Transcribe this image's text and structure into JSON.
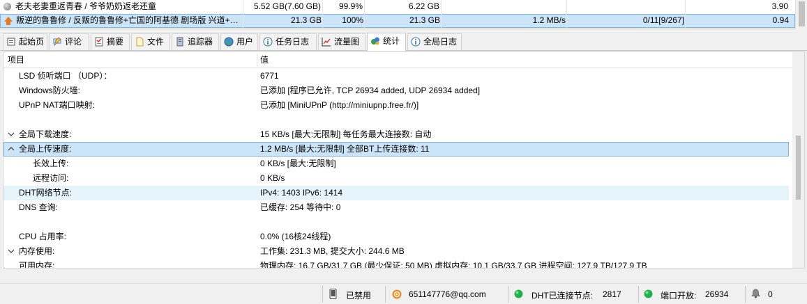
{
  "torrents": [
    {
      "name": "老夫老妻重返青春 / 爷爷奶奶返老还童",
      "size": "5.52 GB(7.60 GB)",
      "done": "99.9%",
      "selected_size": "6.22 GB",
      "down_speed": "",
      "peers": "",
      "ratio": "3.90",
      "state_icon": "paused-gray-dot-icon"
    },
    {
      "name": "叛逆的鲁鲁修 / 反叛的鲁鲁修+亡国的阿基德 剧场版 兴道+…",
      "size": "21.3 GB",
      "done": "100%",
      "selected_size": "21.3 GB",
      "down_speed": "1.2 MB/s",
      "peers": "0/11[9/267]",
      "ratio": "0.94",
      "state_icon": "seeding-up-arrow-icon"
    }
  ],
  "tabs": [
    {
      "label": "起始页",
      "icon": "home-icon"
    },
    {
      "label": "评论",
      "icon": "comment-icon"
    },
    {
      "label": "摘要",
      "icon": "checklist-icon"
    },
    {
      "label": "文件",
      "icon": "file-icon"
    },
    {
      "label": "追踪器",
      "icon": "server-icon"
    },
    {
      "label": "用户",
      "icon": "globe-icon"
    },
    {
      "label": "任务日志",
      "icon": "info-icon"
    },
    {
      "label": "流量图",
      "icon": "chart-icon"
    },
    {
      "label": "统计",
      "icon": "stats-icon"
    },
    {
      "label": "全局日志",
      "icon": "info-icon"
    }
  ],
  "active_tab": "统计",
  "stats": {
    "header": {
      "item": "项目",
      "value": "值"
    },
    "rows": [
      {
        "key": "LSD 侦听端口 （UDP）：",
        "value": "6771",
        "level": 1
      },
      {
        "key": "Windows防火墙:",
        "value": "已添加 [程序已允许, TCP 26934 added, UDP 26934 added]",
        "level": 1
      },
      {
        "key": "UPnP NAT端口映射:",
        "value": "已添加 [MiniUPnP (http://miniupnp.free.fr/)]",
        "level": 1
      },
      {
        "key": "",
        "value": "",
        "level": 1
      },
      {
        "key": "全局下载速度:",
        "value": "15 KB/s [最大:无限制]     每任务最大连接数: 自动",
        "level": 1,
        "chevron": "down"
      },
      {
        "key": "全局上传速度:",
        "value": "1.2 MB/s [最大:无限制]     全部BT上传连接数: 11",
        "level": 1,
        "chevron": "up",
        "selected": true
      },
      {
        "key": "长效上传:",
        "value": "0 KB/s [最大:无限制]",
        "level": 2
      },
      {
        "key": "远程访问:",
        "value": "0 KB/s",
        "level": 2
      },
      {
        "key": "DHT网络节点:",
        "value": "IPv4: 1403  IPv6: 1414",
        "level": 1,
        "hover": true
      },
      {
        "key": "DNS 查询:",
        "value": "已缓存:   254   等待中:   0",
        "level": 1
      },
      {
        "key": "",
        "value": "",
        "level": 1
      },
      {
        "key": "CPU 占用率:",
        "value": "0.0% (16核24线程)",
        "level": 1
      },
      {
        "key": "内存使用:",
        "value": "工作集: 231.3 MB, 提交大小: 244.6 MB",
        "level": 1,
        "chevron": "down"
      },
      {
        "key": "可用内存:",
        "value": "物理内存: 16.7 GB/31.7 GB (最少保证: 50 MB)  虚拟内存: 10.1 GB/33.7 GB  进程空间: 127.9 TB/127.9 TB",
        "level": 1
      }
    ]
  },
  "statusbar": {
    "disabled_label": "已禁用",
    "account": "651147776@qq.com",
    "dht_label": "DHT已连接节点:",
    "dht_value": "2817",
    "port_label": "端口开放:",
    "port_value": "26934",
    "alerts_count": "0"
  },
  "colors": {
    "selection_bg": "#cce4f7",
    "selection_border": "#7eb4ea",
    "hover_bg": "#e5f3fb",
    "status_green": "#22b14c",
    "seed_orange": "#e57a1f"
  }
}
